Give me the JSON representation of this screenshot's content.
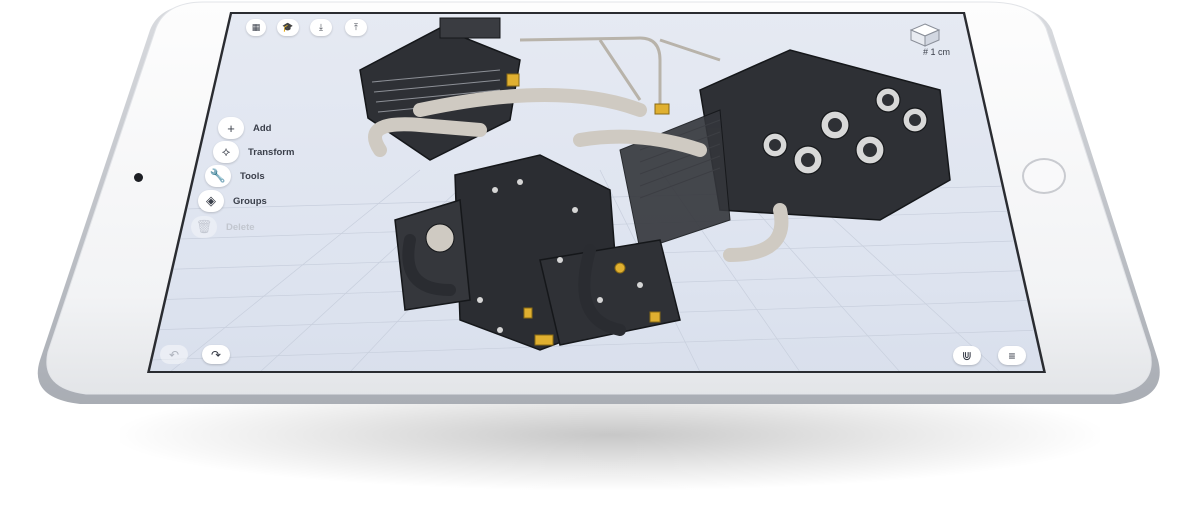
{
  "toolbar": {
    "top_icons": [
      "grid-icon",
      "graduation-cap-icon",
      "import-icon",
      "export-icon"
    ]
  },
  "side_menu": {
    "items": [
      {
        "label": "Add",
        "icon": "plus-icon",
        "enabled": true
      },
      {
        "label": "Transform",
        "icon": "transform-icon",
        "enabled": true
      },
      {
        "label": "Tools",
        "icon": "wrench-icon",
        "enabled": true
      },
      {
        "label": "Groups",
        "icon": "layers-icon",
        "enabled": true
      },
      {
        "label": "Delete",
        "icon": "trash-icon",
        "enabled": false
      }
    ]
  },
  "view": {
    "scale_label": "# 1 cm",
    "view_cube_icon": "view-cube-icon"
  },
  "bottom": {
    "undo_icon": "undo-icon",
    "redo_icon": "redo-icon",
    "snap_icon": "magnet-icon",
    "menu_icon": "list-icon"
  },
  "colors": {
    "screen_bg": "#dde3ef",
    "engine_dark": "#2e3035",
    "engine_metal": "#c9c5bd",
    "brass": "#e0b030",
    "frame": "#f2f3f5"
  }
}
